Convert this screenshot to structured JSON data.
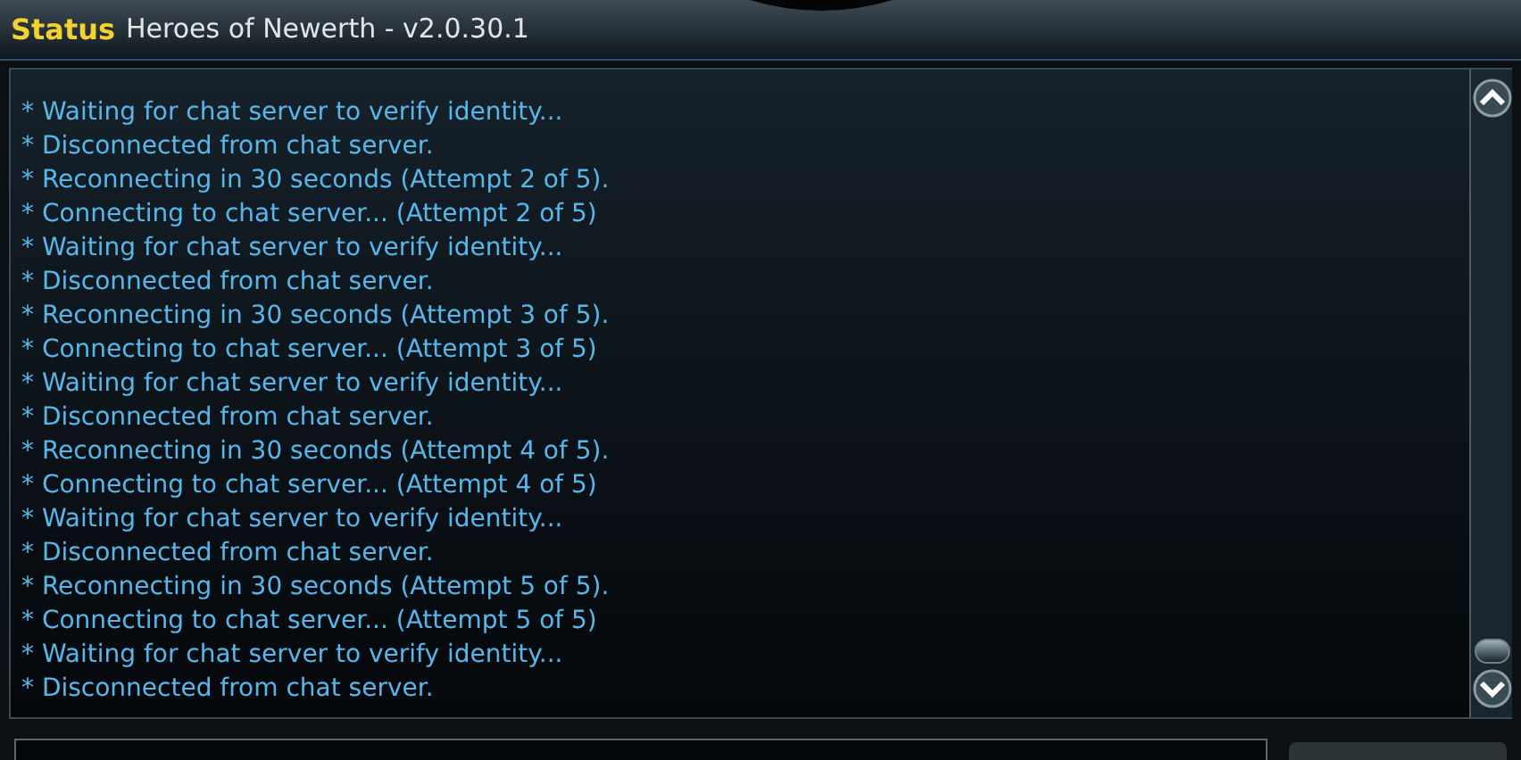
{
  "title": {
    "label": "Status",
    "subtitle": "Heroes of Newerth - v2.0.30.1"
  },
  "log": [
    "* Waiting for chat server to verify identity...",
    "* Disconnected from chat server.",
    "* Reconnecting in 30 seconds (Attempt 2 of 5).",
    "* Connecting to chat server... (Attempt 2 of 5)",
    "* Waiting for chat server to verify identity...",
    "* Disconnected from chat server.",
    "* Reconnecting in 30 seconds (Attempt 3 of 5).",
    "* Connecting to chat server... (Attempt 3 of 5)",
    "* Waiting for chat server to verify identity...",
    "* Disconnected from chat server.",
    "* Reconnecting in 30 seconds (Attempt 4 of 5).",
    "* Connecting to chat server... (Attempt 4 of 5)",
    "* Waiting for chat server to verify identity...",
    "* Disconnected from chat server.",
    "* Reconnecting in 30 seconds (Attempt 5 of 5).",
    "* Connecting to chat server... (Attempt 5 of 5)",
    "* Waiting for chat server to verify identity...",
    "* Disconnected from chat server."
  ]
}
